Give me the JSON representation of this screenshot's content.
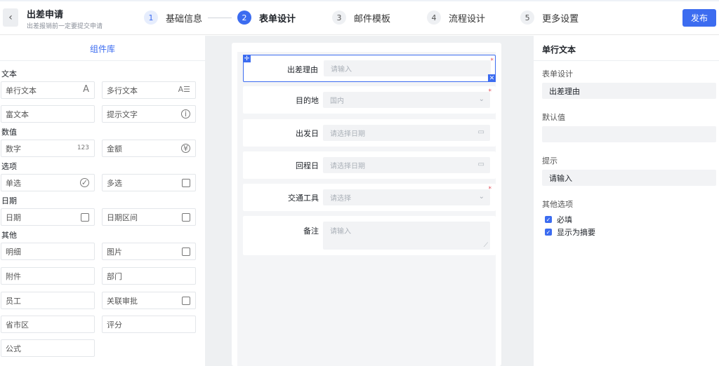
{
  "header": {
    "back_icon": "chevron-left-icon",
    "title": "出差申请",
    "subtitle": "出差报销前一定要提交申请",
    "steps": [
      {
        "num": "1",
        "label": "基础信息"
      },
      {
        "num": "2",
        "label": "表单设计"
      },
      {
        "num": "3",
        "label": "邮件模板"
      },
      {
        "num": "4",
        "label": "流程设计"
      },
      {
        "num": "5",
        "label": "更多设置"
      }
    ],
    "active_step": 2,
    "publish_label": "发布"
  },
  "library": {
    "title": "组件库",
    "groups": {
      "text": "文本",
      "number": "数值",
      "option": "选项",
      "date": "日期",
      "other": "其他"
    },
    "items": {
      "single_text": "单行文本",
      "multi_text": "多行文本",
      "rich_text": "富文本",
      "hint_text": "提示文字",
      "number": "数字",
      "number_icon": "123",
      "amount": "金额",
      "radio": "单选",
      "checkbox": "多选",
      "date": "日期",
      "date_range": "日期区间",
      "detail": "明细",
      "image": "图片",
      "attachment": "附件",
      "department": "部门",
      "employee": "员工",
      "related_approval": "关联审批",
      "region": "省市区",
      "rating": "评分",
      "formula": "公式"
    }
  },
  "form": {
    "fields": [
      {
        "label": "出差理由",
        "placeholder": "请输入"
      },
      {
        "label": "目的地",
        "placeholder": "国内"
      },
      {
        "label": "出发日",
        "placeholder": "请选择日期"
      },
      {
        "label": "回程日",
        "placeholder": "请选择日期"
      },
      {
        "label": "交通工具",
        "placeholder": "请选择"
      },
      {
        "label": "备注",
        "placeholder": "请输入"
      }
    ],
    "required_mark": "*"
  },
  "props": {
    "title": "单行文本",
    "form_design_label": "表单设计",
    "form_design_value": "出差理由",
    "default_label": "默认值",
    "default_value": "",
    "hint_label": "提示",
    "hint_value": "请输入",
    "other_label": "其他选项",
    "opt_required": "必填",
    "opt_summary": "显示为摘要"
  },
  "colors": {
    "accent": "#3c6cf0",
    "required": "#e34d59"
  }
}
